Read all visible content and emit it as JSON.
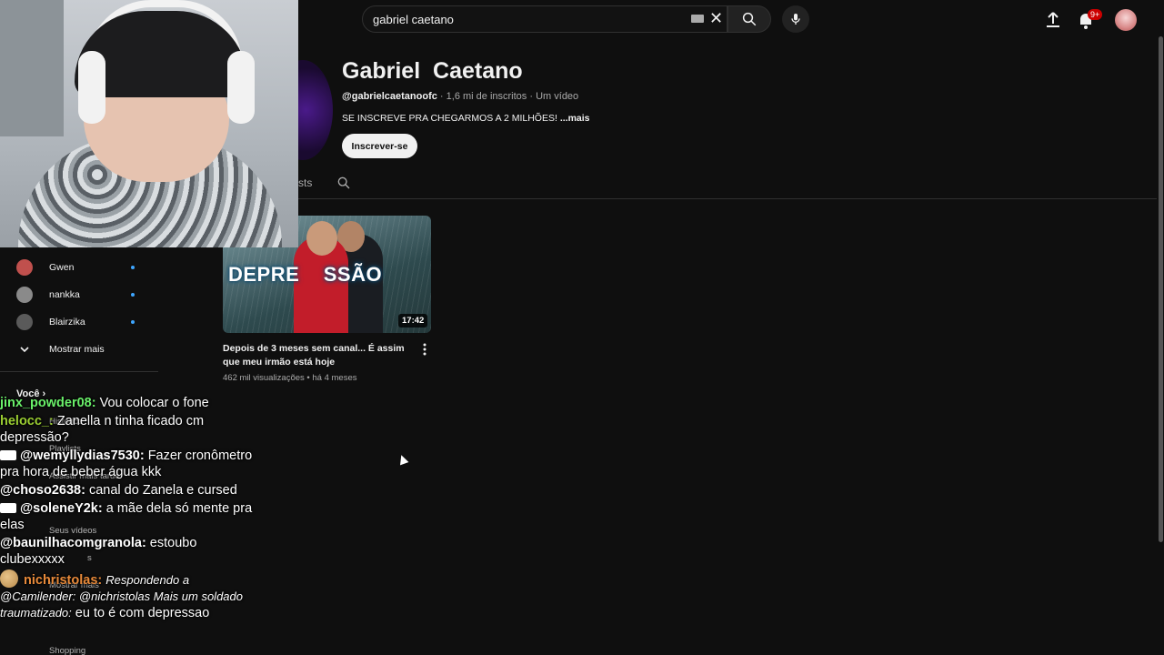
{
  "header": {
    "search_value": "gabriel caetano",
    "notifications_badge": "9+"
  },
  "channel": {
    "name": "Gabriel  Caetano",
    "handle": "@gabrielcaetanoofc",
    "subscribers": "1,6 mi de inscritos",
    "videos": "Um vídeo",
    "separator": " · ",
    "description": "SE INSCREVE PRA CHEGARMOS A 2 MILHÕES!",
    "more": " ...mais",
    "subscribe_label": "Inscrever-se",
    "tab_partial": "sts"
  },
  "video": {
    "thumbnail_text": "DEPRE    SSÃO",
    "duration": "17:42",
    "title": "Depois de 3 meses sem canal... É assim que meu irmão está hoje",
    "views": "462 mil visualizações",
    "age": "há 4 meses",
    "sep": " • "
  },
  "sidebar": {
    "subscriptions": [
      {
        "name": "Gwen",
        "color": "#c0504d"
      },
      {
        "name": "nankka",
        "color": "#8a8a8a"
      },
      {
        "name": "Blairzika",
        "color": "#5a5a5a"
      }
    ],
    "show_more": "Mostrar mais",
    "you_section": "Você",
    "ghost_items": [
      "Histórico",
      "Playlists",
      "Assistir mais tarde",
      "Seus vídeos",
      "Mostrar mais"
    ],
    "ghost_partial": "s",
    "ghost_bottom": "Shopping"
  },
  "chat": [
    {
      "user": "jinx_powder08:",
      "color": "#6af06a",
      "text": " Vou colocar o fone",
      "badge": false
    },
    {
      "user": "helocc_:",
      "color": "#9acd32",
      "text": " Zanella n tinha ficado cm depressão?",
      "badge": false
    },
    {
      "user": "@wemyllydias7530:",
      "color": "#ffffff",
      "text": " Fazer cronômetro pra hora de beber água kkk",
      "badge": true
    },
    {
      "user": "@choso2638:",
      "color": "#ffffff",
      "text": " canal do Zanela e cursed",
      "badge": false
    },
    {
      "user": "@soleneY2k:",
      "color": "#ffffff",
      "text": " a mãe dela só mente pra elas",
      "badge": true
    },
    {
      "user": "@baunilhacomgranola:",
      "color": "#ffffff",
      "text": " estoubo clubexxxxx",
      "badge": false
    }
  ],
  "chat_reply": {
    "user": "nichristolas:",
    "color": "#e88a3a",
    "reply_prefix": "Respondendo a @Camilender: @nichristolas Mais um soldado traumatizado:",
    "text": " eu to é com depressao"
  },
  "colors": {
    "background": "#0f0f0f",
    "accent_dot": "#3ea6ff",
    "badge_red": "#cc0000"
  }
}
